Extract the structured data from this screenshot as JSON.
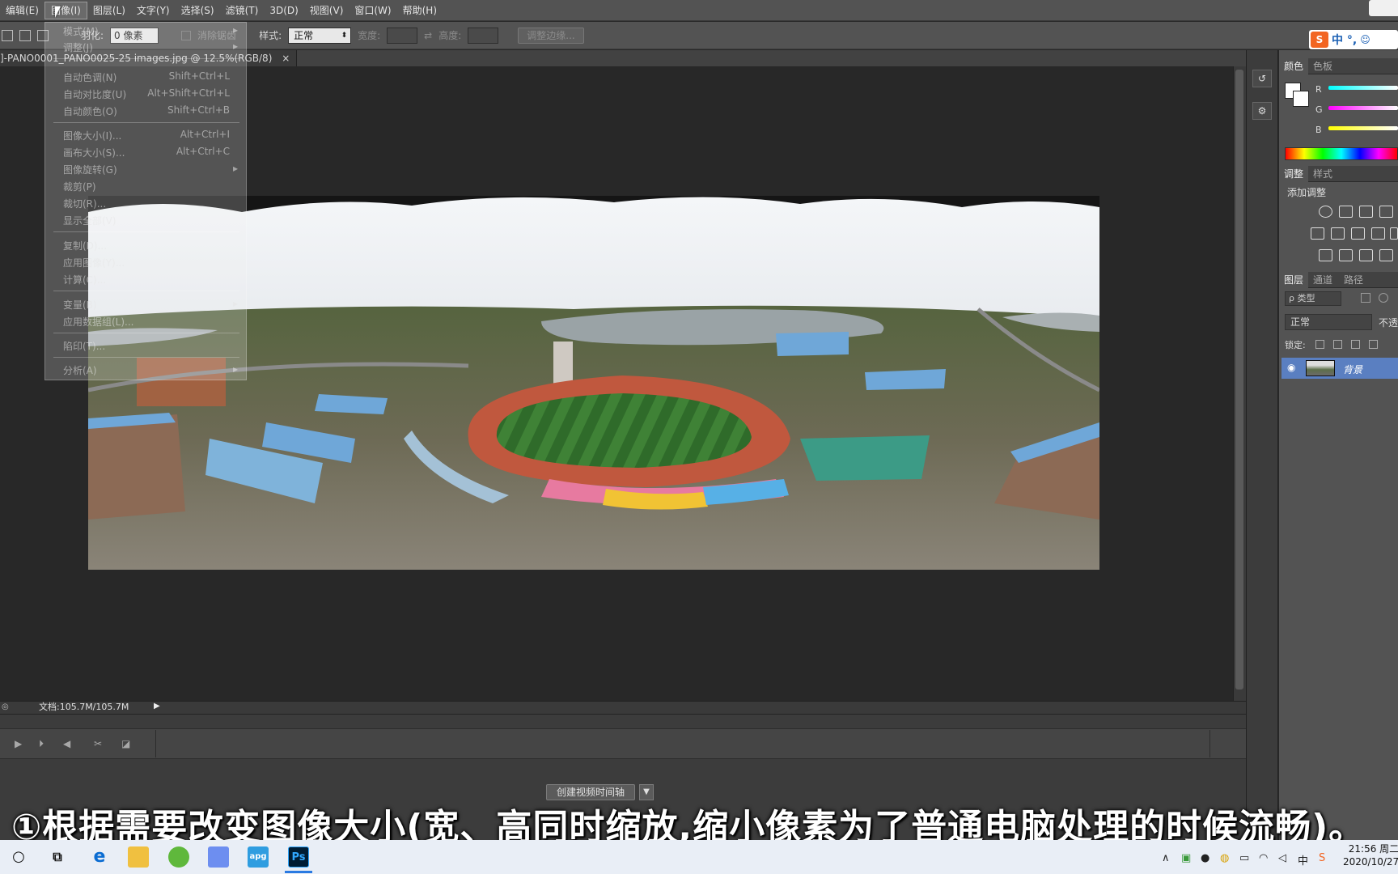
{
  "menubar": {
    "items": [
      "编辑(E)",
      "图像(I)",
      "图层(L)",
      "文字(Y)",
      "选择(S)",
      "滤镜(T)",
      "3D(D)",
      "视图(V)",
      "窗口(W)",
      "帮助(H)"
    ]
  },
  "options": {
    "feather_label": "羽化:",
    "feather_value": "0 像素",
    "antialias_label": "消除锯齿",
    "style_label": "样式:",
    "style_value": "正常",
    "width_label": "宽度:",
    "height_label": "高度:",
    "refine_button": "调整边缘..."
  },
  "document": {
    "tab_title": "]-PANO0001_PANO0025-25 images.jpg @ 12.5%(RGB/8)",
    "close_glyph": "×",
    "status": "文档:105.7M/105.7M"
  },
  "image_menu": {
    "items": [
      {
        "label": "模式(M)",
        "shortcut": "",
        "submenu": true
      },
      {
        "label": "调整(J)",
        "shortcut": "",
        "submenu": true
      },
      {
        "label": "自动色调(N)",
        "shortcut": "Shift+Ctrl+L"
      },
      {
        "label": "自动对比度(U)",
        "shortcut": "Alt+Shift+Ctrl+L"
      },
      {
        "label": "自动颜色(O)",
        "shortcut": "Shift+Ctrl+B"
      },
      {
        "label": "图像大小(I)...",
        "shortcut": "Alt+Ctrl+I"
      },
      {
        "label": "画布大小(S)...",
        "shortcut": "Alt+Ctrl+C"
      },
      {
        "label": "图像旋转(G)",
        "shortcut": "",
        "submenu": true
      },
      {
        "label": "裁剪(P)",
        "shortcut": ""
      },
      {
        "label": "裁切(R)...",
        "shortcut": ""
      },
      {
        "label": "显示全部(V)",
        "shortcut": ""
      },
      {
        "label": "复制(D)...",
        "shortcut": ""
      },
      {
        "label": "应用图像(Y)...",
        "shortcut": ""
      },
      {
        "label": "计算(C)...",
        "shortcut": ""
      },
      {
        "label": "变量(B)",
        "shortcut": "",
        "submenu": true
      },
      {
        "label": "应用数据组(L)...",
        "shortcut": ""
      },
      {
        "label": "陷印(T)...",
        "shortcut": ""
      },
      {
        "label": "分析(A)",
        "shortcut": "",
        "submenu": true
      }
    ]
  },
  "timeline": {
    "create_button": "创建视频时间轴"
  },
  "color_panel": {
    "tabs": [
      "颜色",
      "色板"
    ],
    "channels": [
      "R",
      "G",
      "B"
    ]
  },
  "adjust_panel": {
    "tabs": [
      "调整",
      "样式"
    ],
    "title": "添加调整"
  },
  "layers_panel": {
    "tabs": [
      "图层",
      "通道",
      "路径"
    ],
    "filter": "ρ 类型",
    "blend_mode": "正常",
    "opacity_label": "不透",
    "lock_label": "锁定:",
    "layer_name": "背景"
  },
  "ime": {
    "label": "中 °,"
  },
  "subtitle": "①根据需要改变图像大小(宽、高同时缩放,缩小像素为了普通电脑处理的时候流畅)。",
  "taskbar": {
    "time": "21:56 周二",
    "date": "2020/10/27",
    "icons": [
      "cortana-icon",
      "task-view-icon",
      "edge-icon",
      "explorer-icon",
      "wechat-icon",
      "photos-icon",
      "app-icon",
      "photoshop-icon"
    ]
  }
}
